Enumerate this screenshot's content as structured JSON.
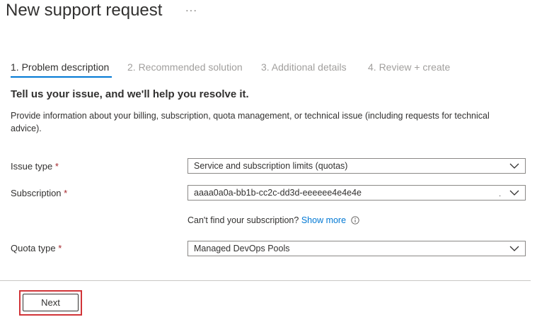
{
  "header": {
    "title": "New support request",
    "more_label": "···"
  },
  "tabs": [
    {
      "label": "1. Problem description",
      "active": true
    },
    {
      "label": "2. Recommended solution",
      "active": false
    },
    {
      "label": "3. Additional details",
      "active": false
    },
    {
      "label": "4. Review + create",
      "active": false
    }
  ],
  "form": {
    "heading": "Tell us your issue, and we'll help you resolve it.",
    "description": "Provide information about your billing, subscription, quota management, or technical issue (including requests for technical advice).",
    "required_marker": "*",
    "issue_type": {
      "label": "Issue type",
      "value": "Service and subscription limits (quotas)"
    },
    "subscription": {
      "label": "Subscription",
      "value": "aaaa0a0a-bb1b-cc2c-dd3d-eeeeee4e4e4e",
      "extra_mark": "."
    },
    "subscription_help": {
      "text": "Can't find your subscription?",
      "link": "Show more",
      "icon": "info-icon"
    },
    "quota_type": {
      "label": "Quota type",
      "value": "Managed DevOps Pools"
    }
  },
  "footer": {
    "next_label": "Next"
  },
  "colors": {
    "accent": "#0078d4",
    "required": "#a4262c",
    "highlight_box": "#d13438",
    "muted_tab": "#a19f9d"
  }
}
